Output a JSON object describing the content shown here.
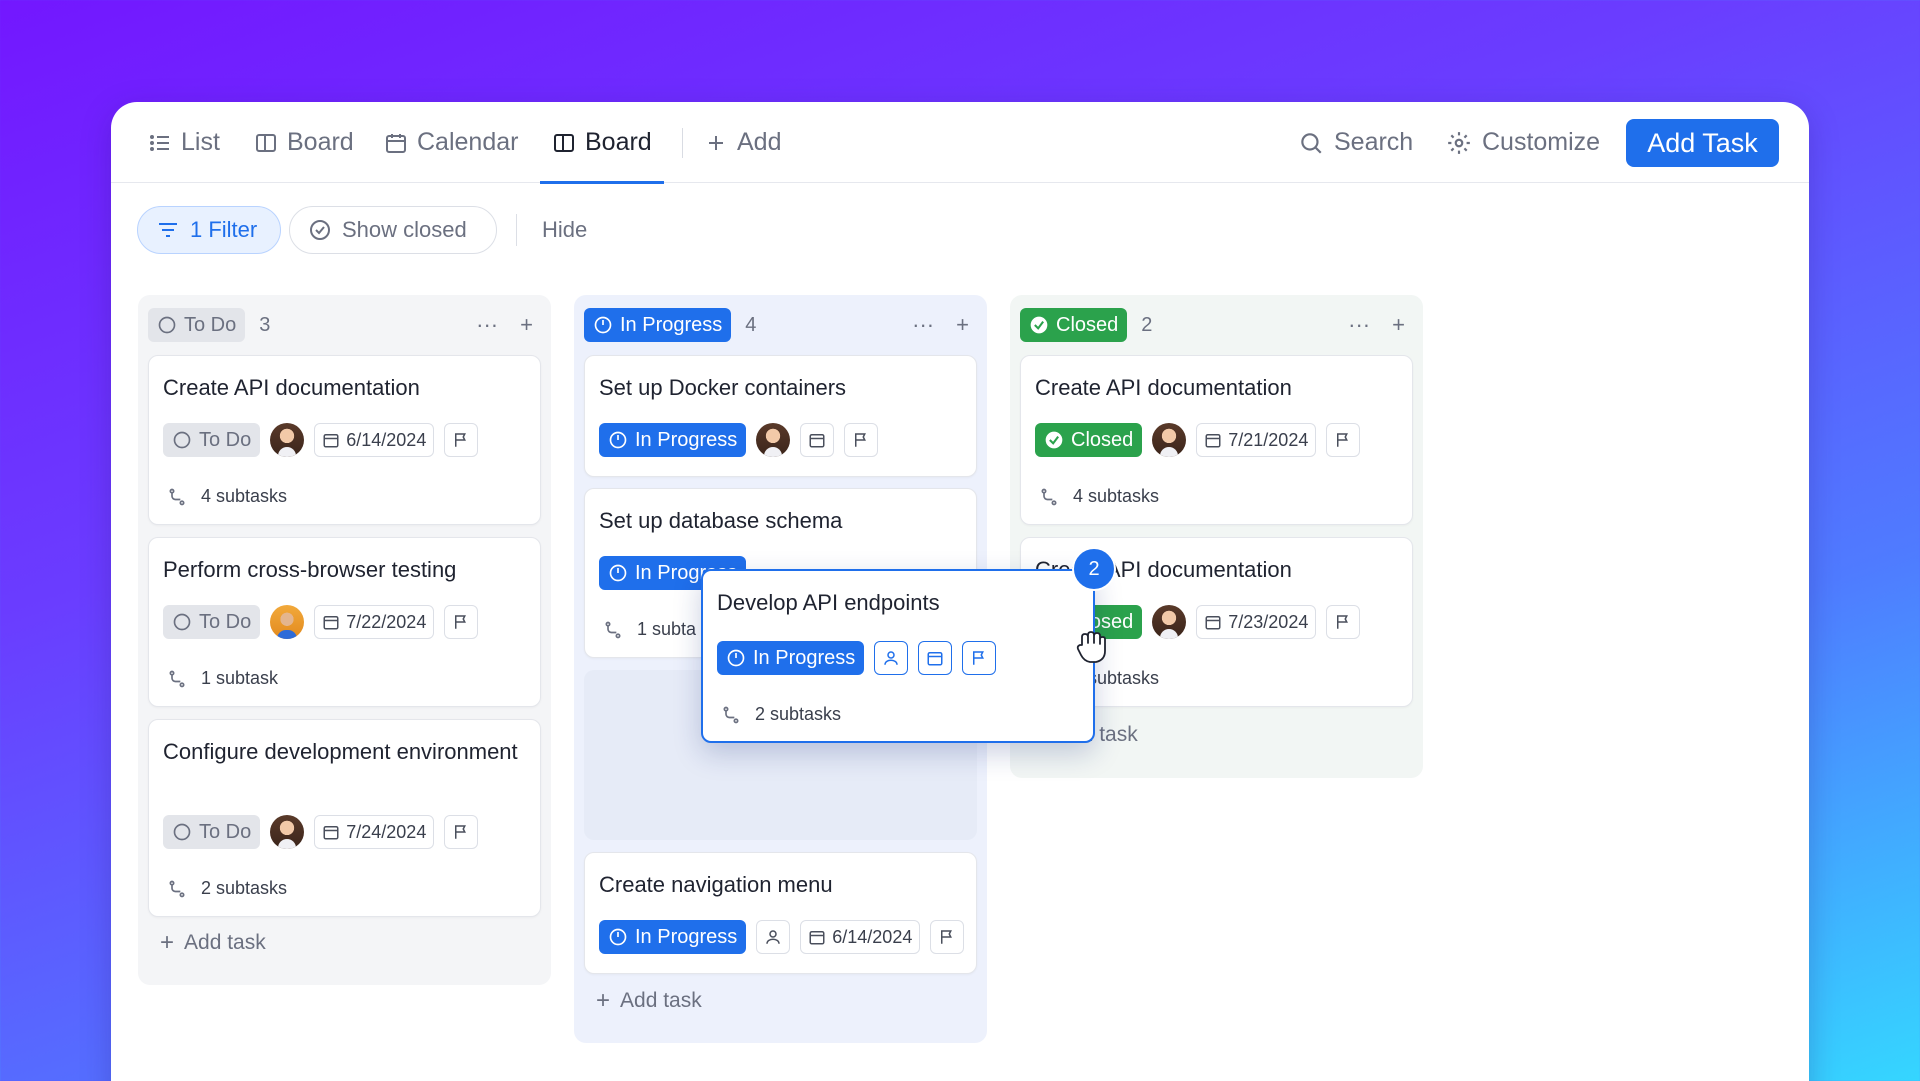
{
  "topbar": {
    "tabs": [
      {
        "label": "List",
        "icon": "list-icon"
      },
      {
        "label": "Board",
        "icon": "board-icon"
      },
      {
        "label": "Calendar",
        "icon": "calendar-icon"
      },
      {
        "label": "Board",
        "icon": "board-icon",
        "active": true
      },
      {
        "label": "Add",
        "icon": "plus-icon"
      }
    ],
    "search_label": "Search",
    "customize_label": "Customize",
    "add_task_label": "Add Task"
  },
  "filters": {
    "filter_label": "1 Filter",
    "show_closed_label": "Show closed",
    "hide_label": "Hide"
  },
  "colors": {
    "accent": "#1f6feb",
    "closed": "#2ba24c",
    "todo": "#e3e5ea"
  },
  "columns": {
    "todo": {
      "status": "To Do",
      "count": "3",
      "add_task": "Add task",
      "cards": [
        {
          "title": "Create API documentation",
          "status": "To Do",
          "date": "6/14/2024",
          "subtasks": "4 subtasks"
        },
        {
          "title": "Perform cross-browser testing",
          "status": "To Do",
          "date": "7/22/2024",
          "subtasks": "1 subtask"
        },
        {
          "title": "Configure development environment",
          "status": "To Do",
          "date": "7/24/2024",
          "subtasks": "2 subtasks"
        }
      ]
    },
    "in_progress": {
      "status": "In Progress",
      "count": "4",
      "add_task": "Add task",
      "cards": [
        {
          "title": "Set up Docker containers",
          "status": "In Progress"
        },
        {
          "title": "Set up database schema",
          "status": "In Progress",
          "subtasks": "1 subta"
        },
        {
          "title": "Create navigation menu",
          "status": "In Progress",
          "date": "6/14/2024"
        }
      ]
    },
    "closed": {
      "status": "Closed",
      "count": "2",
      "add_task": "Add task",
      "cards": [
        {
          "title": "Create API documentation",
          "status": "Closed",
          "date": "7/21/2024",
          "subtasks": "4 subtasks"
        },
        {
          "title": "Create API documentation",
          "status": "Closed",
          "date": "7/23/2024",
          "subtasks": "4 subtasks"
        }
      ]
    }
  },
  "dragging": {
    "title": "Develop API endpoints",
    "status": "In Progress",
    "subtasks": "2 subtasks",
    "selection_count": "2"
  }
}
